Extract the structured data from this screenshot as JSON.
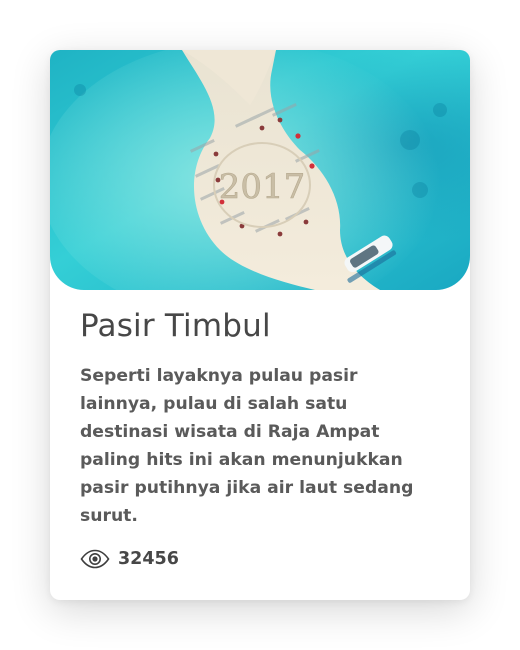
{
  "card": {
    "title": "Pasir Timbul",
    "description": "Seperti layaknya pulau pasir lainnya, pulau di salah satu destinasi wisata di Raja Ampat paling hits ini akan menunjukkan pasir putihnya jika air laut sedang surut.",
    "views": {
      "icon": "eye-icon",
      "count": "32456"
    },
    "image": {
      "written_in_sand": "2017"
    }
  },
  "colors": {
    "sea": "#2ec7cf",
    "sand": "#f2e8d6",
    "title_text": "#474747",
    "body_text": "#5a5a5a"
  }
}
